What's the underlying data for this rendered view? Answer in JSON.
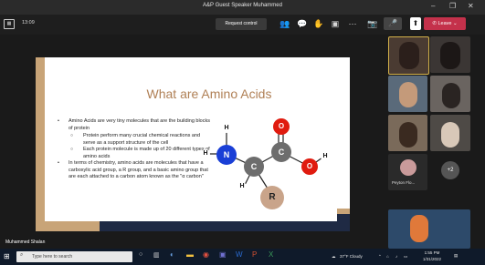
{
  "window": {
    "title": "A&P Guest Speaker Muhammed"
  },
  "toolbar": {
    "timer": "13:09",
    "request_control": "Request control",
    "leave": "Leave"
  },
  "slide": {
    "title": "What are Amino Acids",
    "bullets": [
      {
        "text": "Amino Acids are very tiny molecules that are the building blocks of protein",
        "sub": [
          "Protein perform many crucial chemical reactions and serve as a support structure of the cell",
          "Each protein molecule is made up of 20 different types of amino acids"
        ]
      },
      {
        "text": "In terms of chemistry, amino acids are molecules that have a carboxylic acid group, a R group, and a basic amino group that are each attached to a  carbon atom known as the \"α carbon\"",
        "sub": []
      }
    ],
    "molecule": {
      "atoms": {
        "h1": "H",
        "n": "N",
        "h2": "H",
        "c1": "C",
        "h3": "H",
        "c2": "C",
        "o1": "O",
        "o2": "O",
        "h4": "H",
        "r": "R"
      }
    }
  },
  "presenter_name": "Muhammed Shalan",
  "participants": {
    "peyton_label": "Peyton Flo...",
    "more_count": "+2"
  },
  "taskbar": {
    "search_placeholder": "Type here to search",
    "weather": "37°F  Cloudy",
    "time": "1:55 PM",
    "date": "1/31/2022"
  }
}
